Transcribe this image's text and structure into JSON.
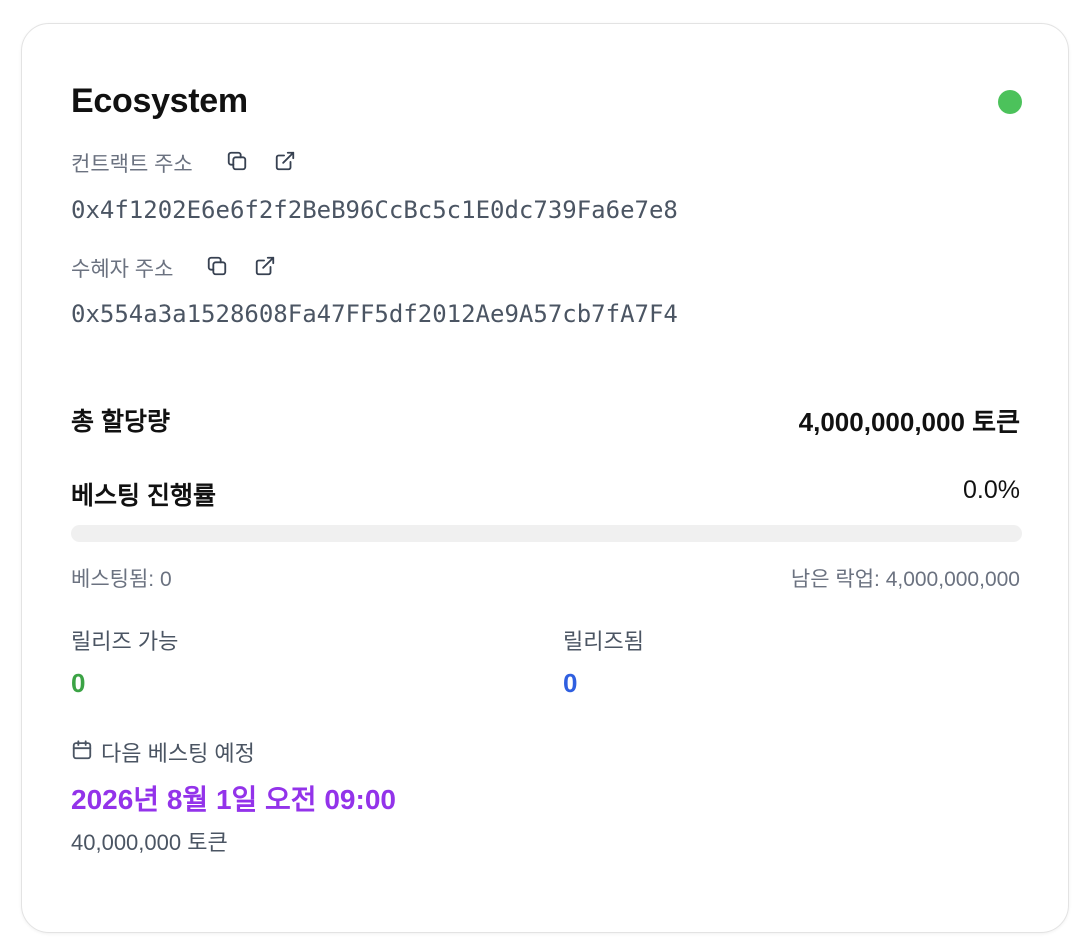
{
  "card": {
    "title": "Ecosystem",
    "status_color": "#4cc25b"
  },
  "contract": {
    "label": "컨트랙트 주소",
    "address": "0x4f1202E6e6f2f2BeB96CcBc5c1E0dc739Fa6e7e8",
    "icons": [
      "copy-icon",
      "external-link-icon"
    ]
  },
  "beneficiary": {
    "label": "수혜자 주소",
    "address": "0x554a3a1528608Fa47FF5df2012Ae9A57cb7fA7F4",
    "icons": [
      "copy-icon",
      "external-link-icon"
    ]
  },
  "allocation": {
    "label": "총 할당량",
    "value": "4,000,000,000 토큰"
  },
  "progress": {
    "label": "베스팅 진행률",
    "percent_text": "0.0%",
    "fraction": 0.0,
    "vested_text": "베스팅됨: 0",
    "remaining_text": "남은 락업: 4,000,000,000"
  },
  "stats": {
    "releasable_label": "릴리즈 가능",
    "releasable_value": "0",
    "releasable_color": "#3ba345",
    "released_label": "릴리즈됨",
    "released_value": "0",
    "released_color": "#2f5fe0"
  },
  "next_vesting": {
    "icon": "calendar-icon",
    "label": "다음 베스팅 예정",
    "date": "2026년 8월 1일 오전 09:00",
    "date_color": "#9333ea",
    "amount": "40,000,000 토큰"
  }
}
